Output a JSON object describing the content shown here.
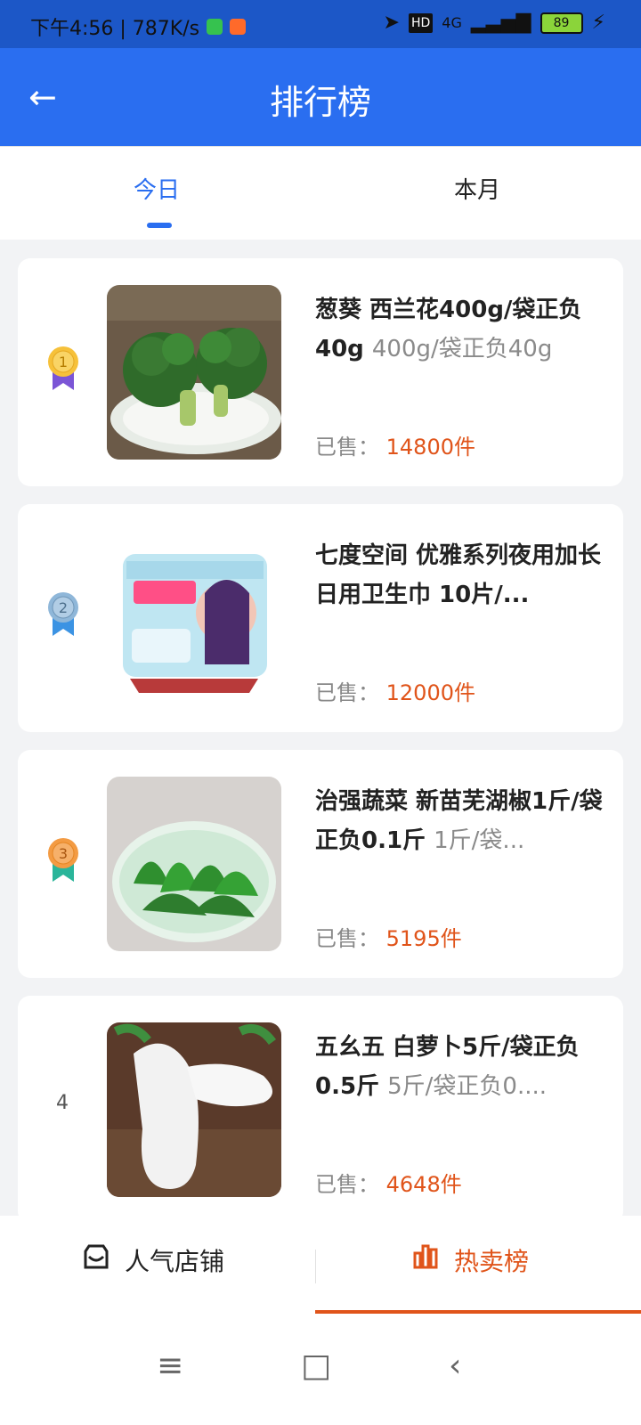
{
  "status": {
    "time_speed": "下午4:56 | 787K/s",
    "network": "4G",
    "battery": "89"
  },
  "header": {
    "title": "排行榜"
  },
  "tabs": [
    {
      "label": "今日",
      "active": true
    },
    {
      "label": "本月",
      "active": false
    }
  ],
  "rank_colors": {
    "1": "#f6c13a",
    "2": "#8fb7d9",
    "3": "#f39b43"
  },
  "items": [
    {
      "rank": "1",
      "title": "葱葵 西兰花400g/袋正负40g",
      "spec": "400g/袋正负40g",
      "sold_label": "已售：",
      "sold_count": "14800件"
    },
    {
      "rank": "2",
      "title": "七度空间 优雅系列夜用加长日用卫生巾 10片/...",
      "spec": "",
      "sold_label": "已售：",
      "sold_count": "12000件"
    },
    {
      "rank": "3",
      "title": "治强蔬菜 新苗芜湖椒1斤/袋正负0.1斤",
      "spec": "1斤/袋...",
      "sold_label": "已售：",
      "sold_count": "5195件"
    },
    {
      "rank": "4",
      "title": "五幺五 白萝卜5斤/袋正负0.5斤",
      "spec": "5斤/袋正负0....",
      "sold_label": "已售：",
      "sold_count": "4648件"
    }
  ],
  "bottom_tabs": [
    {
      "label": "人气店铺",
      "active": false,
      "icon": "store-icon"
    },
    {
      "label": "热卖榜",
      "active": true,
      "icon": "bar-chart-icon"
    }
  ],
  "accent": "#2a6ef0",
  "hot": "#e0541a"
}
